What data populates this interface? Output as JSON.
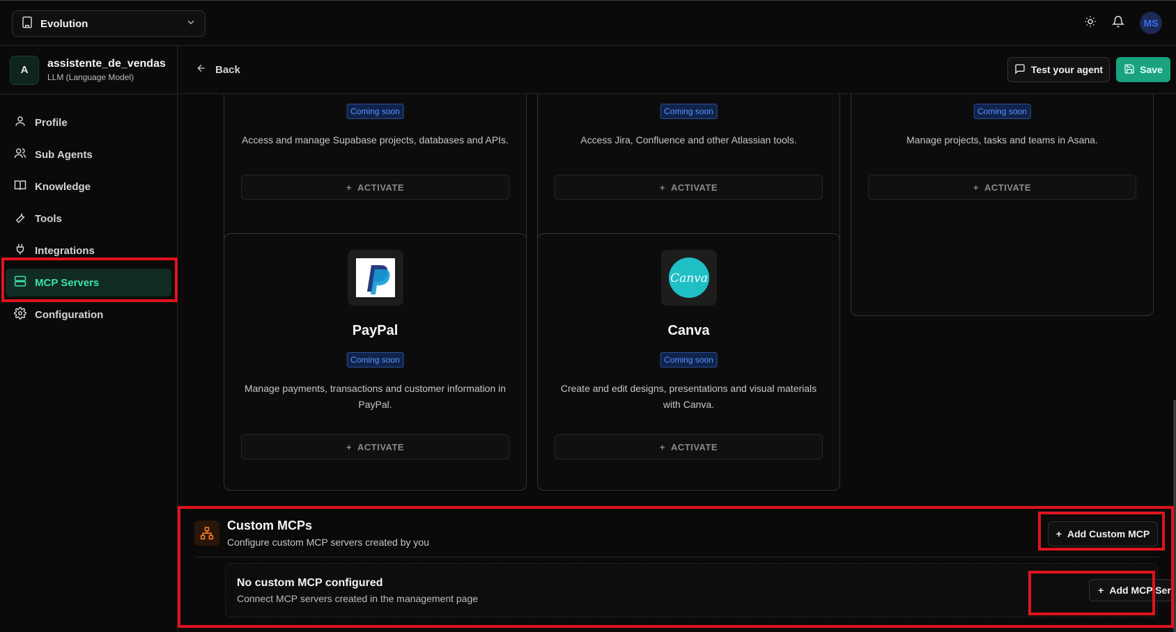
{
  "topbar": {
    "workspace_name": "Evolution",
    "user_initials": "MS"
  },
  "agent": {
    "initial": "A",
    "name": "assistente_de_vendas",
    "type": "LLM (Language Model)"
  },
  "sidebar": {
    "items": [
      {
        "label": "Profile",
        "icon": "user-icon"
      },
      {
        "label": "Sub Agents",
        "icon": "users-icon"
      },
      {
        "label": "Knowledge",
        "icon": "book-icon"
      },
      {
        "label": "Tools",
        "icon": "wrench-icon"
      },
      {
        "label": "Integrations",
        "icon": "plug-icon"
      },
      {
        "label": "MCP Servers",
        "icon": "server-icon",
        "active": true
      },
      {
        "label": "Configuration",
        "icon": "gear-icon"
      }
    ]
  },
  "header": {
    "back_label": "Back",
    "test_label": "Test your agent",
    "save_label": "Save"
  },
  "cards": [
    {
      "badge": "Coming soon",
      "description": "Access and manage Supabase projects, databases and APIs.",
      "action": "ACTIVATE"
    },
    {
      "badge": "Coming soon",
      "description": "Access Jira, Confluence and other Atlassian tools.",
      "action": "ACTIVATE"
    },
    {
      "badge": "Coming soon",
      "description": "Manage projects, tasks and teams in Asana.",
      "action": "ACTIVATE"
    },
    {
      "title": "PayPal",
      "badge": "Coming soon",
      "description": "Manage payments, transactions and customer information in PayPal.",
      "action": "ACTIVATE",
      "logo": "paypal-logo"
    },
    {
      "title": "Canva",
      "badge": "Coming soon",
      "description": "Create and edit designs, presentations and visual materials with Canva.",
      "action": "ACTIVATE",
      "logo": "canva-logo",
      "logo_text": "Canva"
    }
  ],
  "custom_mcps": {
    "title": "Custom MCPs",
    "subtitle": "Configure custom MCP servers created by you",
    "add_button": "Add Custom MCP",
    "empty_title": "No custom MCP configured",
    "empty_subtitle": "Connect MCP servers created in the management page",
    "add_server_button": "Add MCP Server"
  },
  "colors": {
    "accent": "#1aa37f",
    "active_nav_text": "#3ee0b0",
    "badge_blue": "#5b93ff",
    "highlight_red": "#e0141e",
    "canva_teal": "#1fbfc6",
    "paypal_blue": "#253b80"
  }
}
